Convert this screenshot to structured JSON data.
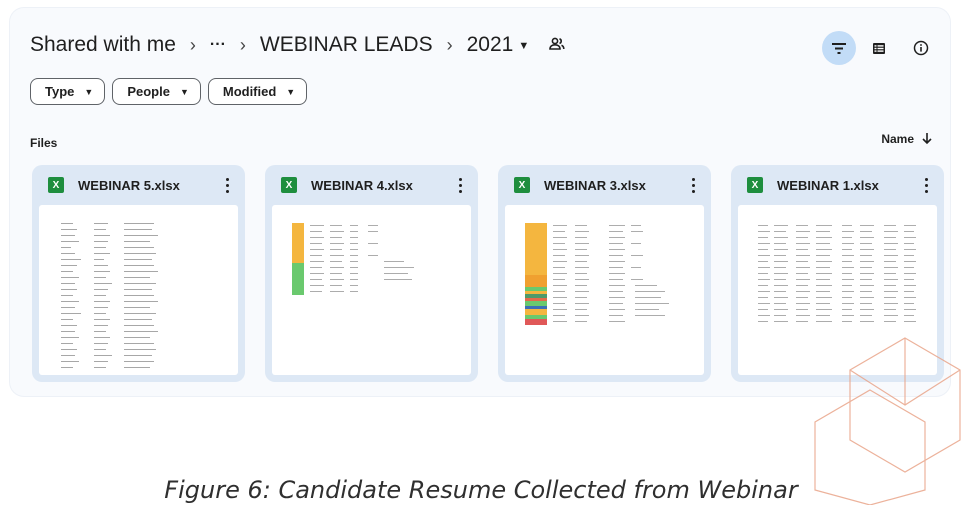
{
  "header": {
    "breadcrumb": [
      "Shared with me",
      "···",
      "WEBINAR LEADS",
      "2021"
    ],
    "icons": {
      "shared_folder": "shared-people-icon",
      "filter": "filter-icon",
      "list_view": "list-view-icon",
      "info": "info-icon"
    },
    "active_button_color": "#c2dcf7"
  },
  "filters": [
    {
      "label": "Type"
    },
    {
      "label": "People"
    },
    {
      "label": "Modified"
    }
  ],
  "section": {
    "title": "Files",
    "sort_label": "Name"
  },
  "files": [
    {
      "name": "WEBINAR 5.xlsx",
      "icon_label": "X",
      "preview": "plain"
    },
    {
      "name": "WEBINAR 4.xlsx",
      "icon_label": "X",
      "preview": "highlighted-orange-green"
    },
    {
      "name": "WEBINAR 3.xlsx",
      "icon_label": "X",
      "preview": "highlighted-multicolor"
    },
    {
      "name": "WEBINAR 1.xlsx",
      "icon_label": "X",
      "preview": "plain-wide"
    }
  ],
  "colors": {
    "excel_green": "#1e8e3e",
    "card_background": "#dde8f5",
    "highlight_orange": "#f4b63f",
    "highlight_green": "#6ac96e"
  },
  "caption": "Figure 6: Candidate Resume Collected from Webinar"
}
